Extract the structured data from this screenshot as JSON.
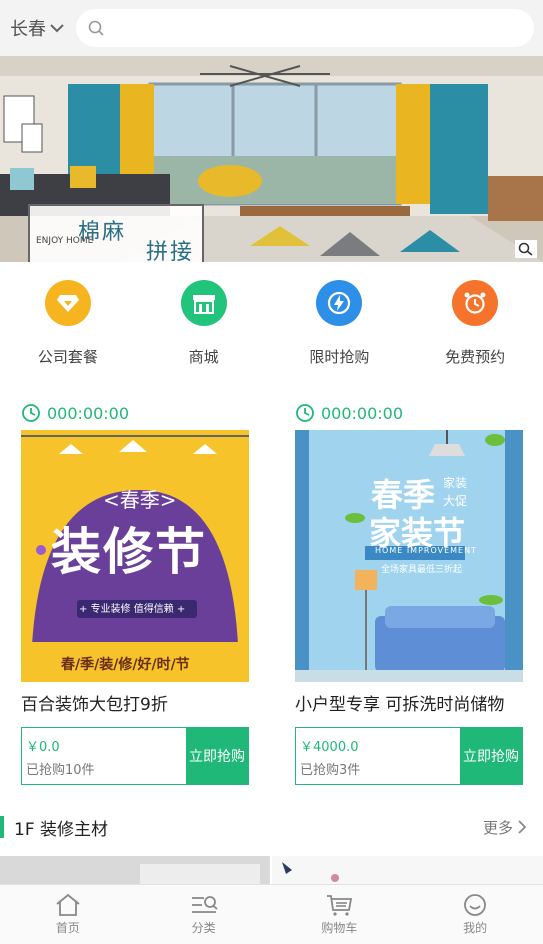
{
  "header": {
    "city": "长春",
    "search_placeholder": ""
  },
  "banner": {
    "tag_line1": "棉麻",
    "tag_line2": "拼接",
    "tag_en": "ENJOY HOME"
  },
  "quick_nav": [
    {
      "label": "公司套餐",
      "icon": "diamond-icon",
      "color": "#f6b51f"
    },
    {
      "label": "商城",
      "icon": "store-icon",
      "color": "#22c47c"
    },
    {
      "label": "限时抢购",
      "icon": "lightning-icon",
      "color": "#2e8fe8"
    },
    {
      "label": "免费预约",
      "icon": "alarm-clock-icon",
      "color": "#f5732a"
    }
  ],
  "flash_sale": [
    {
      "timer": "000:00:00",
      "title": "百合装饰大包打9折",
      "price": "￥0.0",
      "sold": "已抢购10件",
      "button": "立即抢购",
      "poster": {
        "top": "<春季>",
        "main": "装修节",
        "badge": "+ 专业装修  值得信赖 +",
        "bottom": "春/季/装/修/好/时/节"
      }
    },
    {
      "timer": "000:00:00",
      "title": "小户型专享 可拆洗时尚储物",
      "price": "￥4000.0",
      "sold": "已抢购3件",
      "button": "立即抢购",
      "poster": {
        "main1": "春季",
        "main2": "家装节",
        "side1": "家装",
        "side2": "大促",
        "en": "HOME IMPROVEMENT",
        "ribbon": "全场家具最低三折起"
      }
    }
  ],
  "section": {
    "title": "1F 装修主材",
    "more": "更多"
  },
  "tabbar": [
    {
      "label": "首页",
      "icon": "home-icon"
    },
    {
      "label": "分类",
      "icon": "category-icon"
    },
    {
      "label": "购物车",
      "icon": "cart-icon"
    },
    {
      "label": "我的",
      "icon": "profile-icon"
    }
  ],
  "colors": {
    "accent": "#1fb878"
  }
}
